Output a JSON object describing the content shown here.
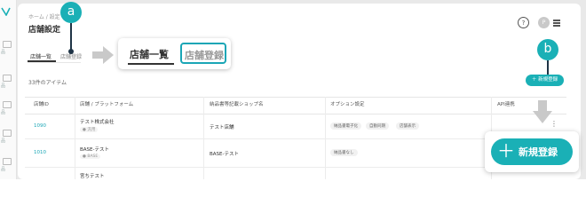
{
  "breadcrumb": "ホーム / 設定",
  "page_title": "店舗設定",
  "header": {
    "help": "?",
    "avatar": "P"
  },
  "tabs": [
    {
      "label": "店舗一覧"
    },
    {
      "label": "店舗登録"
    }
  ],
  "callouts": {
    "a": "a",
    "b": "b"
  },
  "zoom_tabs": [
    {
      "label": "店舗一覧"
    },
    {
      "label": "店舗登録"
    }
  ],
  "new_button_small": "＋ 新規登録",
  "item_count": "33件のアイテム",
  "table": {
    "columns": [
      "店舗ID",
      "店舗 / プラットフォーム",
      "納品書等記載ショップ名",
      "オプション設定",
      "API連携"
    ],
    "rows": [
      {
        "id": "1090",
        "name": "テスト株式会社",
        "platform": "● 汎用",
        "shop": "テスト店舗",
        "options": [
          "納品書電子化",
          "自動同期",
          "店舗表示"
        ]
      },
      {
        "id": "1010",
        "name": "BASE-テスト",
        "platform": "● BASE",
        "shop": "BASE-テスト",
        "options": [
          "納品書なし"
        ]
      },
      {
        "id": "",
        "name": "宮ちテスト",
        "platform": "",
        "shop": "",
        "options": []
      }
    ]
  },
  "new_button_large": {
    "plus": "＋",
    "label": "新規登録"
  },
  "sidebar_labels": [
    "品",
    "品",
    "品",
    "品",
    "品"
  ]
}
